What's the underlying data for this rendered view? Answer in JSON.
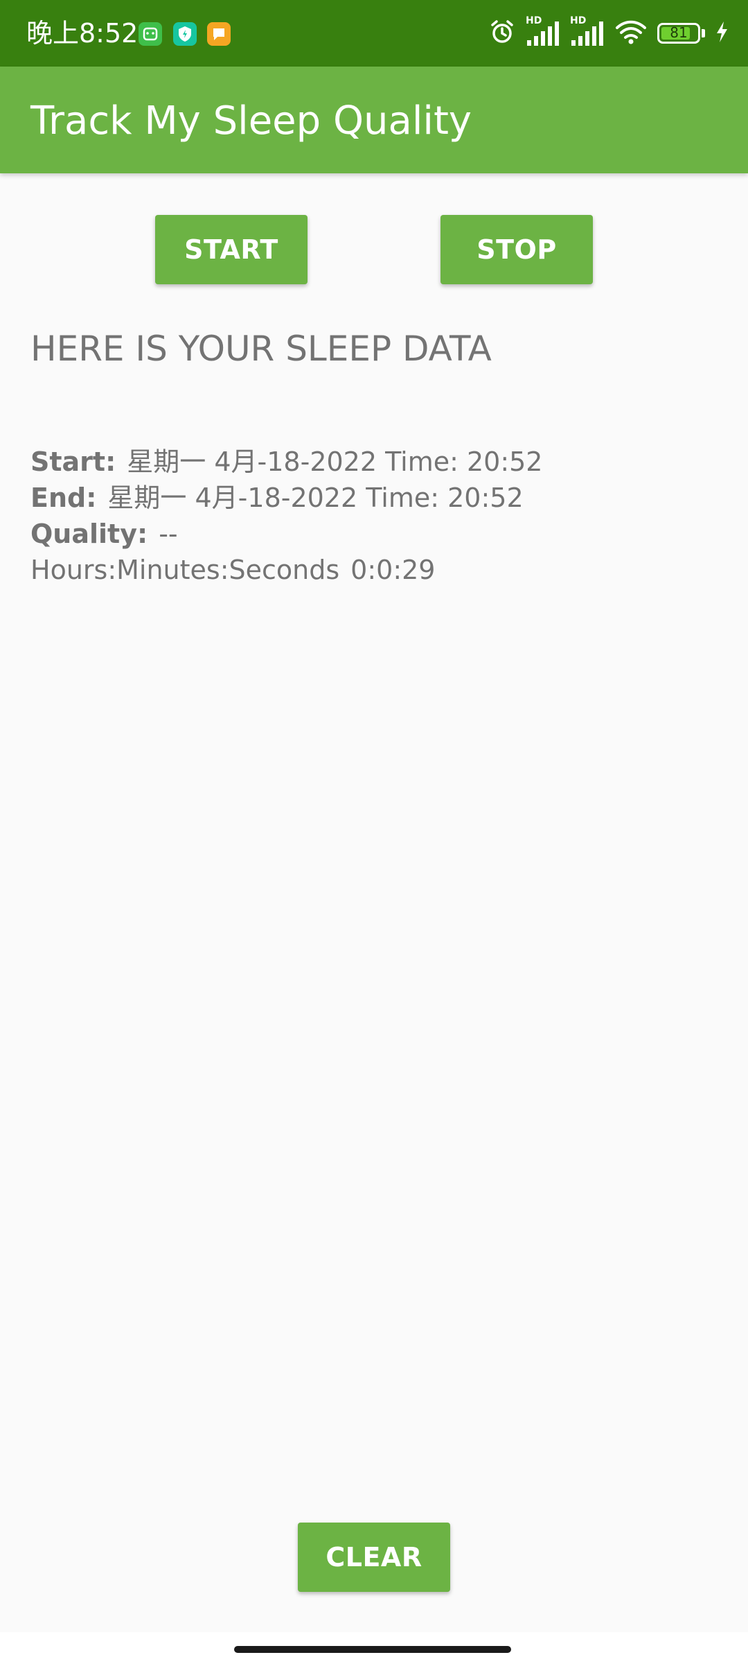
{
  "status_bar": {
    "time": "晚上8:52",
    "battery_level": "81",
    "battery_fraction": 0.81,
    "background_color": "#38800f",
    "notification_icons": [
      "app-notification-green-icon",
      "shield-notification-icon",
      "message-notification-icon"
    ],
    "system_icons": [
      "alarm-icon",
      "signal-hd-icon",
      "signal-hd-icon",
      "wifi-icon",
      "battery-icon",
      "charging-icon"
    ],
    "hd_label_1": "HD",
    "hd_label_2": "HD"
  },
  "app_bar": {
    "title": "Track My Sleep Quality",
    "color": "#6cb344"
  },
  "buttons": {
    "start": "START",
    "stop": "STOP",
    "clear": "CLEAR"
  },
  "content": {
    "heading": "HERE IS YOUR SLEEP DATA",
    "start_label": "Start:",
    "start_value": "星期一 4月-18-2022 Time: 20:52",
    "end_label": "End:",
    "end_value": "星期一 4月-18-2022 Time: 20:52",
    "quality_label": "Quality:",
    "quality_value": "--",
    "duration_label": "Hours:Minutes:Seconds",
    "duration_value": "0:0:29",
    "text_color": "#737373"
  }
}
